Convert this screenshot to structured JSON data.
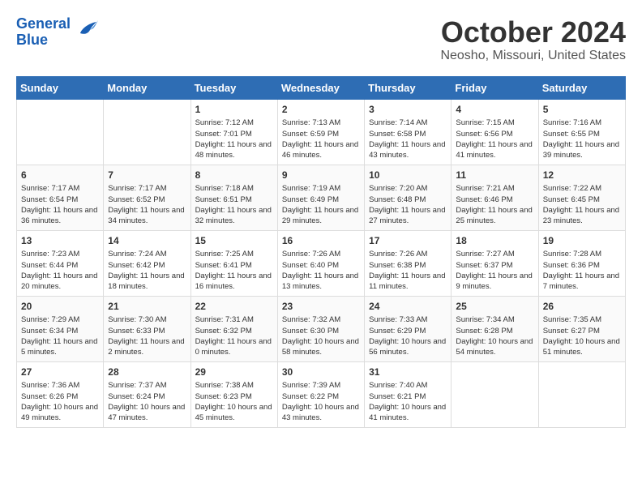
{
  "header": {
    "logo_line1": "General",
    "logo_line2": "Blue",
    "month_title": "October 2024",
    "location": "Neosho, Missouri, United States"
  },
  "days_of_week": [
    "Sunday",
    "Monday",
    "Tuesday",
    "Wednesday",
    "Thursday",
    "Friday",
    "Saturday"
  ],
  "weeks": [
    [
      {
        "day": "",
        "content": ""
      },
      {
        "day": "",
        "content": ""
      },
      {
        "day": "1",
        "content": "Sunrise: 7:12 AM\nSunset: 7:01 PM\nDaylight: 11 hours and 48 minutes."
      },
      {
        "day": "2",
        "content": "Sunrise: 7:13 AM\nSunset: 6:59 PM\nDaylight: 11 hours and 46 minutes."
      },
      {
        "day": "3",
        "content": "Sunrise: 7:14 AM\nSunset: 6:58 PM\nDaylight: 11 hours and 43 minutes."
      },
      {
        "day": "4",
        "content": "Sunrise: 7:15 AM\nSunset: 6:56 PM\nDaylight: 11 hours and 41 minutes."
      },
      {
        "day": "5",
        "content": "Sunrise: 7:16 AM\nSunset: 6:55 PM\nDaylight: 11 hours and 39 minutes."
      }
    ],
    [
      {
        "day": "6",
        "content": "Sunrise: 7:17 AM\nSunset: 6:54 PM\nDaylight: 11 hours and 36 minutes."
      },
      {
        "day": "7",
        "content": "Sunrise: 7:17 AM\nSunset: 6:52 PM\nDaylight: 11 hours and 34 minutes."
      },
      {
        "day": "8",
        "content": "Sunrise: 7:18 AM\nSunset: 6:51 PM\nDaylight: 11 hours and 32 minutes."
      },
      {
        "day": "9",
        "content": "Sunrise: 7:19 AM\nSunset: 6:49 PM\nDaylight: 11 hours and 29 minutes."
      },
      {
        "day": "10",
        "content": "Sunrise: 7:20 AM\nSunset: 6:48 PM\nDaylight: 11 hours and 27 minutes."
      },
      {
        "day": "11",
        "content": "Sunrise: 7:21 AM\nSunset: 6:46 PM\nDaylight: 11 hours and 25 minutes."
      },
      {
        "day": "12",
        "content": "Sunrise: 7:22 AM\nSunset: 6:45 PM\nDaylight: 11 hours and 23 minutes."
      }
    ],
    [
      {
        "day": "13",
        "content": "Sunrise: 7:23 AM\nSunset: 6:44 PM\nDaylight: 11 hours and 20 minutes."
      },
      {
        "day": "14",
        "content": "Sunrise: 7:24 AM\nSunset: 6:42 PM\nDaylight: 11 hours and 18 minutes."
      },
      {
        "day": "15",
        "content": "Sunrise: 7:25 AM\nSunset: 6:41 PM\nDaylight: 11 hours and 16 minutes."
      },
      {
        "day": "16",
        "content": "Sunrise: 7:26 AM\nSunset: 6:40 PM\nDaylight: 11 hours and 13 minutes."
      },
      {
        "day": "17",
        "content": "Sunrise: 7:26 AM\nSunset: 6:38 PM\nDaylight: 11 hours and 11 minutes."
      },
      {
        "day": "18",
        "content": "Sunrise: 7:27 AM\nSunset: 6:37 PM\nDaylight: 11 hours and 9 minutes."
      },
      {
        "day": "19",
        "content": "Sunrise: 7:28 AM\nSunset: 6:36 PM\nDaylight: 11 hours and 7 minutes."
      }
    ],
    [
      {
        "day": "20",
        "content": "Sunrise: 7:29 AM\nSunset: 6:34 PM\nDaylight: 11 hours and 5 minutes."
      },
      {
        "day": "21",
        "content": "Sunrise: 7:30 AM\nSunset: 6:33 PM\nDaylight: 11 hours and 2 minutes."
      },
      {
        "day": "22",
        "content": "Sunrise: 7:31 AM\nSunset: 6:32 PM\nDaylight: 11 hours and 0 minutes."
      },
      {
        "day": "23",
        "content": "Sunrise: 7:32 AM\nSunset: 6:30 PM\nDaylight: 10 hours and 58 minutes."
      },
      {
        "day": "24",
        "content": "Sunrise: 7:33 AM\nSunset: 6:29 PM\nDaylight: 10 hours and 56 minutes."
      },
      {
        "day": "25",
        "content": "Sunrise: 7:34 AM\nSunset: 6:28 PM\nDaylight: 10 hours and 54 minutes."
      },
      {
        "day": "26",
        "content": "Sunrise: 7:35 AM\nSunset: 6:27 PM\nDaylight: 10 hours and 51 minutes."
      }
    ],
    [
      {
        "day": "27",
        "content": "Sunrise: 7:36 AM\nSunset: 6:26 PM\nDaylight: 10 hours and 49 minutes."
      },
      {
        "day": "28",
        "content": "Sunrise: 7:37 AM\nSunset: 6:24 PM\nDaylight: 10 hours and 47 minutes."
      },
      {
        "day": "29",
        "content": "Sunrise: 7:38 AM\nSunset: 6:23 PM\nDaylight: 10 hours and 45 minutes."
      },
      {
        "day": "30",
        "content": "Sunrise: 7:39 AM\nSunset: 6:22 PM\nDaylight: 10 hours and 43 minutes."
      },
      {
        "day": "31",
        "content": "Sunrise: 7:40 AM\nSunset: 6:21 PM\nDaylight: 10 hours and 41 minutes."
      },
      {
        "day": "",
        "content": ""
      },
      {
        "day": "",
        "content": ""
      }
    ]
  ]
}
